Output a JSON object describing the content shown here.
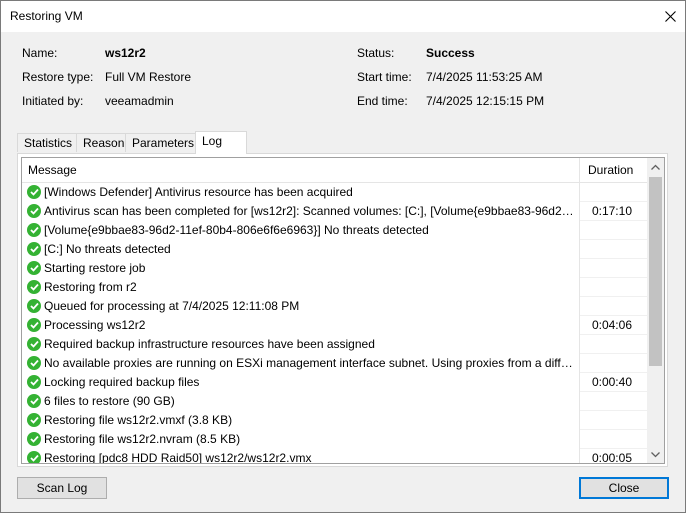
{
  "window": {
    "title": "Restoring VM"
  },
  "info": {
    "name_label": "Name:",
    "name_value": "ws12r2",
    "restore_type_label": "Restore type:",
    "restore_type_value": "Full VM Restore",
    "initiated_label": "Initiated by:",
    "initiated_value": "veeamadmin",
    "status_label": "Status:",
    "status_value": "Success",
    "start_label": "Start time:",
    "start_value": "7/4/2025 11:53:25 AM",
    "end_label": "End time:",
    "end_value": "7/4/2025 12:15:15 PM"
  },
  "tabs": [
    "Statistics",
    "Reason",
    "Parameters",
    "Log"
  ],
  "active_tab": "Log",
  "log": {
    "columns": {
      "message": "Message",
      "duration": "Duration"
    },
    "rows": [
      {
        "message": "[Windows Defender] Antivirus resource has been acquired",
        "duration": ""
      },
      {
        "message": "Antivirus scan has been completed for [ws12r2]: Scanned volumes: [C:], [Volume{e9bbae83-96d2-11...",
        "duration": "0:17:10"
      },
      {
        "message": "[Volume{e9bbae83-96d2-11ef-80b4-806e6f6e6963}] No threats detected",
        "duration": ""
      },
      {
        "message": "[C:] No threats detected",
        "duration": ""
      },
      {
        "message": "Starting restore job",
        "duration": ""
      },
      {
        "message": "Restoring from r2",
        "duration": ""
      },
      {
        "message": "Queued for processing at 7/4/2025 12:11:08 PM",
        "duration": ""
      },
      {
        "message": "Processing ws12r2",
        "duration": "0:04:06"
      },
      {
        "message": "Required backup infrastructure resources have been assigned",
        "duration": ""
      },
      {
        "message": "No available proxies are running on ESXi management interface subnet. Using proxies from a differ...",
        "duration": ""
      },
      {
        "message": "Locking required backup files",
        "duration": "0:00:40"
      },
      {
        "message": "6 files to restore (90 GB)",
        "duration": ""
      },
      {
        "message": "Restoring file ws12r2.vmxf (3.8 KB)",
        "duration": ""
      },
      {
        "message": "Restoring file ws12r2.nvram (8.5 KB)",
        "duration": ""
      },
      {
        "message": "Restoring [pdc8 HDD Raid50] ws12r2/ws12r2.vmx",
        "duration": "0:00:05"
      }
    ]
  },
  "buttons": {
    "scan_log": "Scan Log",
    "close": "Close"
  },
  "colors": {
    "success_icon": "#34b233",
    "accent": "#0078d7"
  },
  "icons": {
    "row_status": "success-check-icon",
    "window_close": "close-icon"
  }
}
